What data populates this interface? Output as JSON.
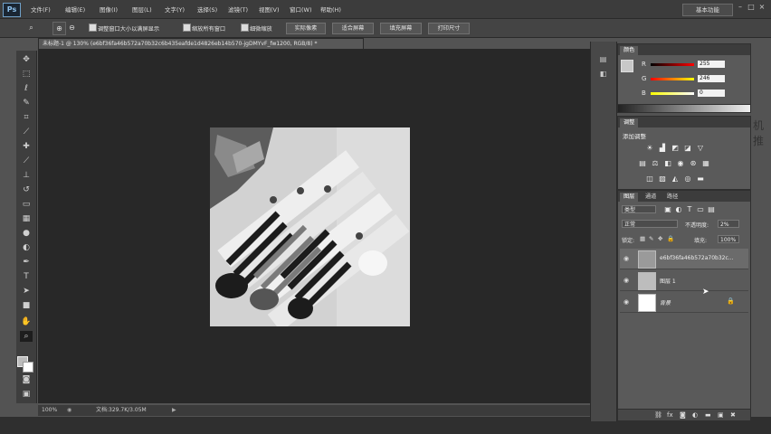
{
  "app": {
    "logo": "Ps"
  },
  "menu": [
    "文件(F)",
    "编辑(E)",
    "图像(I)",
    "图层(L)",
    "文字(Y)",
    "选择(S)",
    "滤镜(T)",
    "视图(V)",
    "窗口(W)",
    "帮助(H)"
  ],
  "workspace": {
    "label": "基本功能"
  },
  "window_controls": {
    "minimize": "–",
    "maximize": "□",
    "close": "×"
  },
  "options_bar": {
    "resize_windows_label": "调整窗口大小以满屏显示",
    "zoom_all_label": "缩放所有窗口",
    "scrubby_zoom_label": "细微缩放",
    "actual_pixels_label": "实际像素",
    "fit_screen_label": "适合屏幕",
    "fill_screen_label": "填充屏幕",
    "print_size_label": "打印尺寸"
  },
  "document": {
    "tab_title": "未标题-1 @ 130% (e6bf36fa46b572a70b32c6b435eafde1d4826eb14b570-jgDMYvF_fw1200, RGB/8) *",
    "zoom": "100%",
    "doc_info": "文档:329.7K/3.05M"
  },
  "color_panel": {
    "tab": "颜色",
    "r_label": "R",
    "g_label": "G",
    "b_label": "B",
    "r_value": "255",
    "g_value": "246",
    "b_value": "0",
    "r_level": 1.0,
    "g_level": 0.96,
    "b_level": 0.0
  },
  "adjustments_panel": {
    "tab": "调整",
    "title": "添加调整"
  },
  "layers_panel": {
    "tabs": [
      "图层",
      "通道",
      "路径"
    ],
    "kind_label": "类型",
    "blend_mode": "正常",
    "opacity_label": "不透明度:",
    "opacity_value": "2%",
    "lock_label": "锁定:",
    "fill_label": "填充:",
    "fill_value": "100%",
    "layers": [
      {
        "name": "e6bf36fa46b572a70b32c..."
      },
      {
        "name": "图层 1"
      },
      {
        "name": "背景"
      }
    ]
  },
  "side_text": "机推",
  "colors": {
    "accent": "#7fb0e0",
    "canvas": "#282828",
    "panel": "#5a5a5a"
  }
}
